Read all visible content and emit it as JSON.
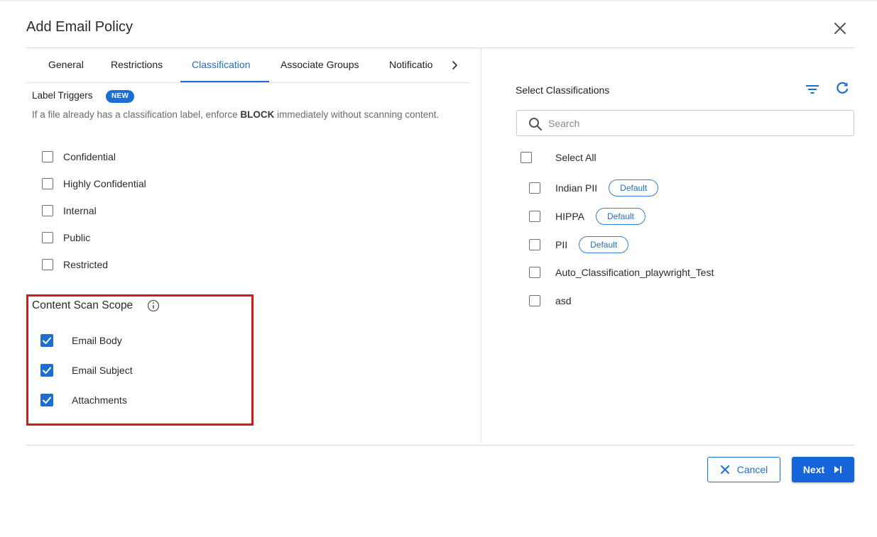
{
  "dialog": {
    "title": "Add Email Policy"
  },
  "tabs": [
    {
      "label": "General"
    },
    {
      "label": "Restrictions"
    },
    {
      "label": "Classification",
      "active": true
    },
    {
      "label": "Associate Groups"
    },
    {
      "label": "Notificatio"
    }
  ],
  "label_triggers": {
    "title": "Label Triggers",
    "badge": "NEW",
    "desc_before": "If a file already has a classification label, enforce ",
    "desc_bold": "BLOCK",
    "desc_after": " immediately without scanning content.",
    "items": [
      {
        "label": "Confidential",
        "checked": false
      },
      {
        "label": "Highly Confidential",
        "checked": false
      },
      {
        "label": "Internal",
        "checked": false
      },
      {
        "label": "Public",
        "checked": false
      },
      {
        "label": "Restricted",
        "checked": false
      }
    ]
  },
  "scan_scope": {
    "title": "Content Scan Scope",
    "items": [
      {
        "label": "Email Body",
        "checked": true
      },
      {
        "label": "Email Subject",
        "checked": true
      },
      {
        "label": "Attachments",
        "checked": true
      }
    ]
  },
  "classifications": {
    "title": "Select Classifications",
    "search_placeholder": "Search",
    "select_all_label": "Select All",
    "items": [
      {
        "label": "Indian PII",
        "badge": "Default",
        "checked": false
      },
      {
        "label": "HIPPA",
        "badge": "Default",
        "checked": false
      },
      {
        "label": "PII",
        "badge": "Default",
        "checked": false
      },
      {
        "label": "Auto_Classification_playwright_Test",
        "badge": "",
        "checked": false
      },
      {
        "label": "asd",
        "badge": "",
        "checked": false
      }
    ]
  },
  "footer": {
    "cancel_label": "Cancel",
    "next_label": "Next"
  },
  "colors": {
    "accent": "#1c6fd1",
    "primary_button": "#1565d8",
    "highlight_box": "#d21c1c"
  },
  "icons": [
    "close-icon",
    "chevron-right-icon",
    "info-icon",
    "filter-icon",
    "refresh-icon",
    "search-icon",
    "check-icon",
    "skip-next-icon"
  ]
}
